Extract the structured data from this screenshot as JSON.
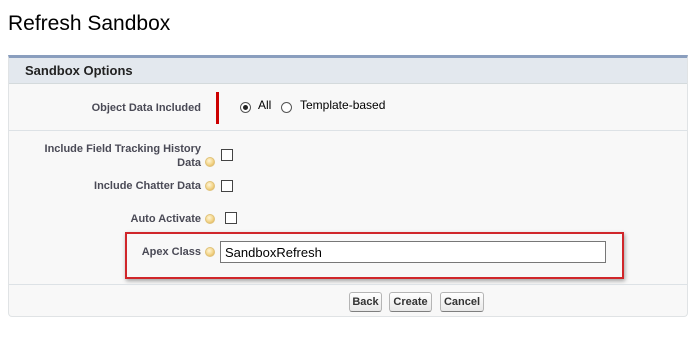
{
  "page": {
    "title": "Refresh Sandbox"
  },
  "section": {
    "title": "Sandbox Options"
  },
  "fields": {
    "object_data": {
      "label": "Object Data Included",
      "options": [
        {
          "label": "All",
          "selected": true
        },
        {
          "label": "Template-based",
          "selected": false
        }
      ]
    },
    "field_tracking": {
      "label_line1": "Include Field Tracking History",
      "label_line2": "Data",
      "checked": false
    },
    "chatter_data": {
      "label": "Include Chatter Data",
      "checked": false
    },
    "auto_activate": {
      "label": "Auto Activate",
      "checked": false
    },
    "apex_class": {
      "label": "Apex Class",
      "value": "SandboxRefresh"
    }
  },
  "buttons": {
    "back": "Back",
    "create": "Create",
    "cancel": "Cancel"
  },
  "colors": {
    "required_bar": "#cc0000",
    "highlight_border": "#d0262a",
    "section_header_bg": "#e3e8ee",
    "panel_top_border": "#8a9ebe"
  },
  "icons": {
    "help": "help-icon"
  }
}
